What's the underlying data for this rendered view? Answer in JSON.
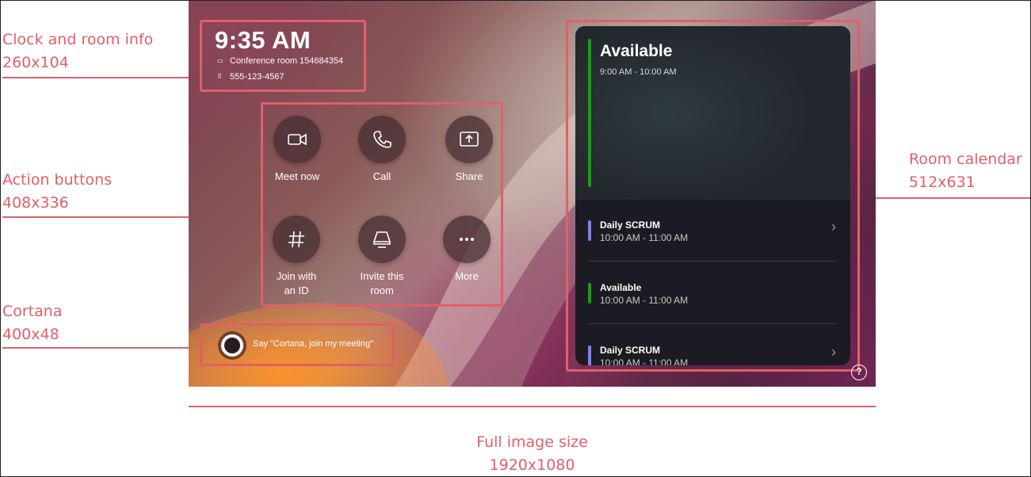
{
  "annotations": {
    "clock": {
      "title": "Clock and room info",
      "size": "260x104"
    },
    "actions": {
      "title": "Action buttons",
      "size": "408x336"
    },
    "cortana": {
      "title": "Cortana",
      "size": "400x48"
    },
    "calendar": {
      "title": "Room calendar",
      "size": "512x631"
    },
    "full": {
      "title": "Full image size",
      "size": "1920x1080"
    }
  },
  "clock": {
    "time": "9:35 AM",
    "room": "Conference room 154684354",
    "phone": "555-123-4567"
  },
  "actions": [
    {
      "label": "Meet now",
      "icon": "video-camera-icon"
    },
    {
      "label": "Call",
      "icon": "phone-icon"
    },
    {
      "label": "Share",
      "icon": "share-screen-icon"
    },
    {
      "label": "Join with an ID",
      "icon": "hash-icon"
    },
    {
      "label": "Invite this room",
      "icon": "invite-room-icon"
    },
    {
      "label": "More",
      "icon": "more-icon"
    }
  ],
  "cortana": {
    "prompt": "Say \"Cortana, join my meeting\""
  },
  "calendar": {
    "current": {
      "title": "Available",
      "time": "9:00 AM - 10:00 AM",
      "color": "#13a10e"
    },
    "items": [
      {
        "title": "Daily SCRUM",
        "time": "10:00 AM - 11:00 AM",
        "color": "#7b83eb",
        "chevron": true
      },
      {
        "title": "Available",
        "time": "10:00 AM - 11:00 AM",
        "color": "#13a10e",
        "chevron": false
      },
      {
        "title": "Daily SCRUM",
        "time": "10:00 AM - 11:00 AM",
        "color": "#7b83eb",
        "chevron": true
      }
    ]
  },
  "help": {
    "icon": "help-icon",
    "glyph": "?"
  },
  "colors": {
    "annotation": "#e0606a",
    "available": "#13a10e",
    "meeting": "#7b83eb"
  }
}
